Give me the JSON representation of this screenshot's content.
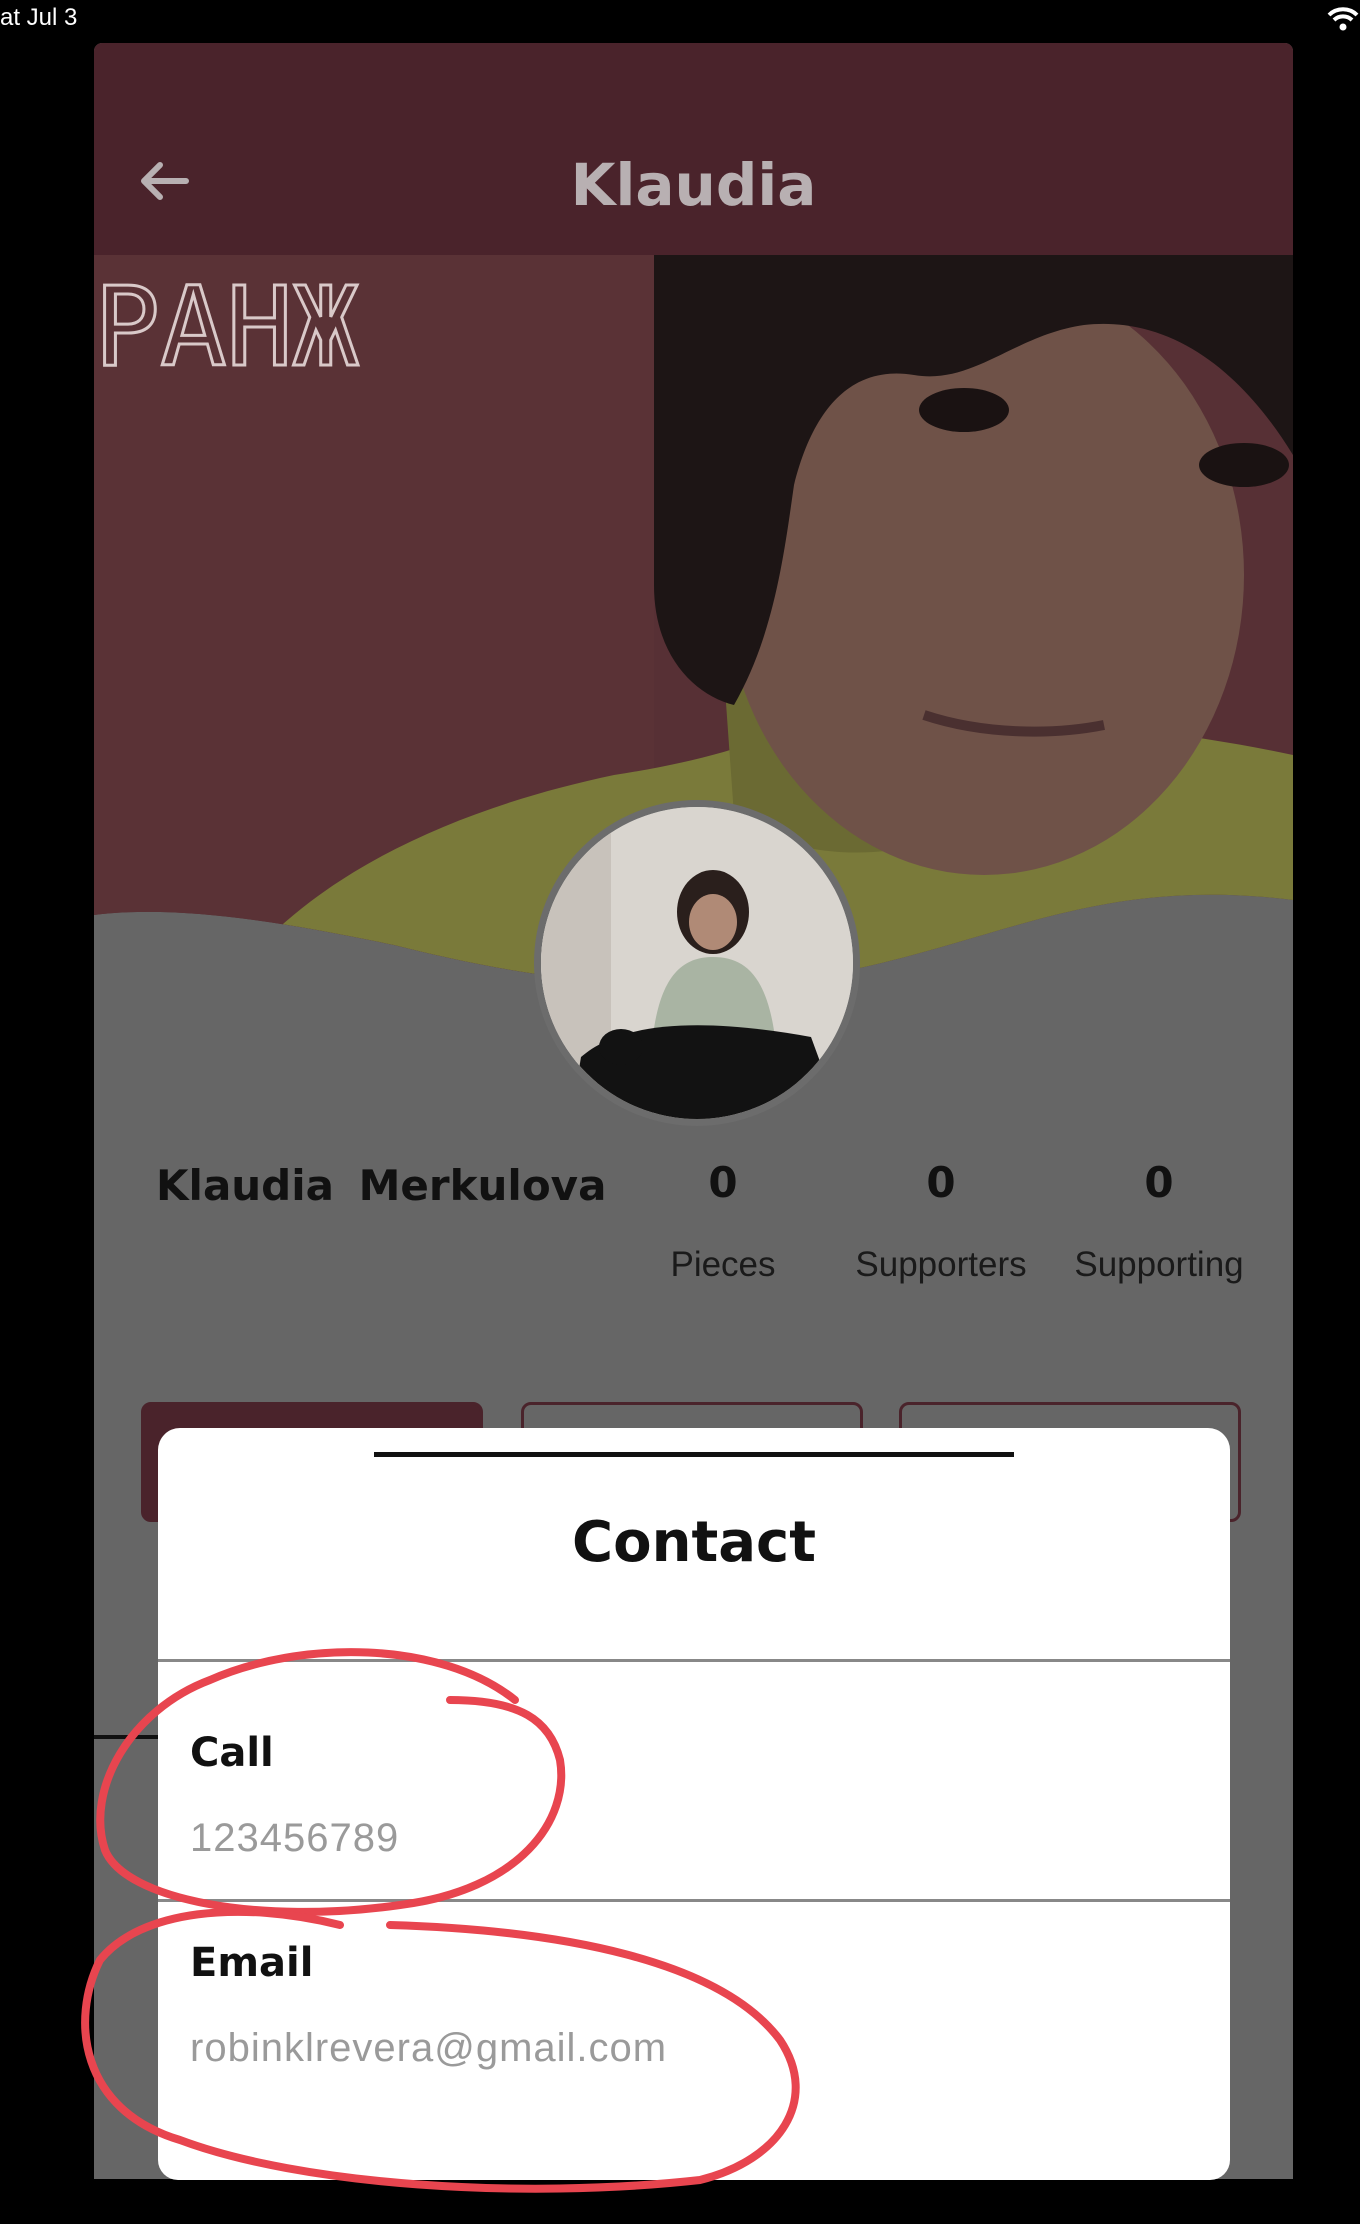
{
  "status_bar": {
    "time_text": "at Jul 3",
    "wifi_icon": "wifi-icon"
  },
  "header": {
    "title": "Klaudia",
    "back_icon": "arrow-left-icon"
  },
  "cover": {
    "sign_text": "PAHЖ"
  },
  "profile": {
    "name": "Klaudia  Merkulova",
    "stats": [
      {
        "value": "0",
        "label": "Pieces"
      },
      {
        "value": "0",
        "label": "Supporters"
      },
      {
        "value": "0",
        "label": "Supporting"
      }
    ]
  },
  "contact_sheet": {
    "title": "Contact",
    "rows": [
      {
        "label": "Call",
        "value": "123456789"
      },
      {
        "label": "Email",
        "value": "robinklrevera@gmail.com"
      }
    ]
  },
  "colors": {
    "header_bg": "#4a232b",
    "dim_overlay": "#666666",
    "annotation": "#e8454f"
  }
}
